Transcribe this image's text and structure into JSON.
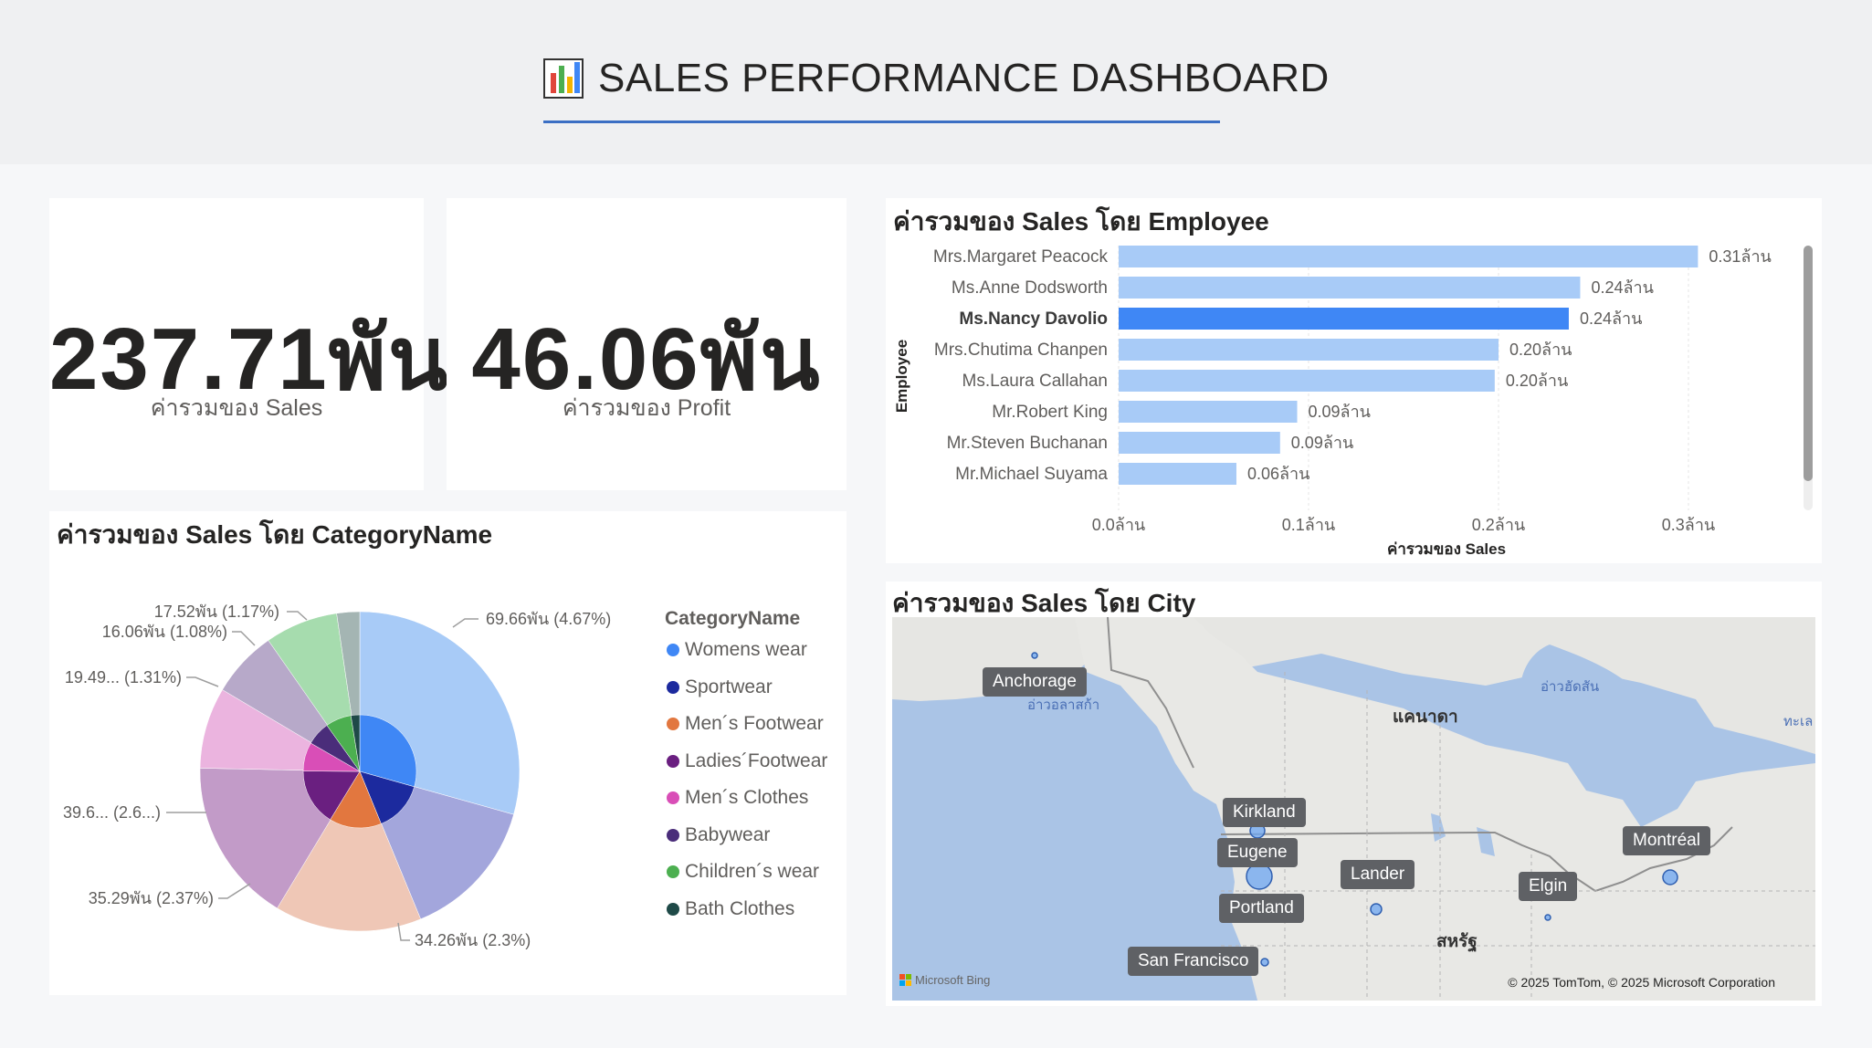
{
  "header": {
    "title": "SALES PERFORMANCE DASHBOARD",
    "icon": "bar-chart-icon"
  },
  "kpis": [
    {
      "value": "237.71พัน",
      "label": "ค่ารวมของ Sales"
    },
    {
      "value": "46.06พัน",
      "label": "ค่ารวมของ Profit"
    }
  ],
  "employee_chart": {
    "title": "ค่ารวมของ Sales โดย Employee",
    "ylabel": "Employee",
    "xlabel": "ค่ารวมของ Sales",
    "ticks": [
      "0.0ล้าน",
      "0.1ล้าน",
      "0.2ล้าน",
      "0.3ล้าน"
    ]
  },
  "category_chart": {
    "title": "ค่ารวมของ Sales โดย CategoryName",
    "legend_title": "CategoryName",
    "labels": [
      "69.66พัน (4.67%)",
      "34.26พัน (2.3%)",
      "35.29พัน (2.37%)",
      "39.6... (2.6...)",
      "19.49... (1.31%)",
      "16.06พัน (1.08%)",
      "17.52พัน (1.17%)"
    ]
  },
  "map": {
    "title": "ค่ารวมของ Sales โดย City",
    "cities": [
      "Anchorage",
      "Kirkland",
      "Eugene",
      "Portland",
      "Lander",
      "Elgin",
      "Montréal",
      "San Francisco"
    ],
    "countries": [
      "แคนาดา",
      "สหรัฐ"
    ],
    "water": [
      "อ่าวอลาสก้า",
      "อ่าวฮัดสัน",
      "ทะเล"
    ],
    "attribution": "© 2025 TomTom, © 2025 Microsoft Corporation",
    "bing": "Microsoft Bing"
  },
  "chart_data": [
    {
      "type": "bar",
      "orientation": "horizontal",
      "title": "ค่ารวมของ Sales โดย Employee",
      "xlabel": "ค่ารวมของ Sales",
      "ylabel": "Employee",
      "xlim": [
        0,
        0.33
      ],
      "categories": [
        "Mrs.Margaret Peacock",
        "Ms.Anne Dodsworth",
        "Ms.Nancy Davolio",
        "Mrs.Chutima Chanpen",
        "Ms.Laura Callahan",
        "Mr.Robert King",
        "Mr.Steven Buchanan",
        "Mr.Michael Suyama"
      ],
      "values": [
        0.305,
        0.243,
        0.237,
        0.2,
        0.198,
        0.094,
        0.085,
        0.062
      ],
      "value_labels": [
        "0.31ล้าน",
        "0.24ล้าน",
        "0.24ล้าน",
        "0.20ล้าน",
        "0.20ล้าน",
        "0.09ล้าน",
        "0.09ล้าน",
        "0.06ล้าน"
      ],
      "highlighted": "Ms.Nancy Davolio",
      "colors": {
        "bar": "#a8cbf7",
        "highlight": "#3f87f5"
      }
    },
    {
      "type": "pie",
      "title": "ค่ารวมของ Sales โดย CategoryName",
      "legend": "right",
      "series": [
        "Womens wear",
        "Sportwear",
        "Men´s Footwear",
        "Ladies´Footwear",
        "Men´s Clothes",
        "Babywear",
        "Children´s wear",
        "Bath Clothes"
      ],
      "series_colors": [
        "#3f87f5",
        "#1c2a9e",
        "#e2773f",
        "#6a1f80",
        "#d94eb7",
        "#4a2d7a",
        "#4caf50",
        "#1f4a48"
      ],
      "outer_values": [
        69.66,
        34.26,
        35.29,
        39.6,
        19.49,
        16.06,
        17.52,
        5.5
      ],
      "outer_labels": [
        "69.66พัน (4.67%)",
        "34.26พัน (2.3%)",
        "35.29พัน (2.37%)",
        "39.6... (2.6...)",
        "19.49... (1.31%)",
        "16.06พัน (1.08%)",
        "17.52พัน (1.17%)",
        ""
      ],
      "outer_colors": [
        "#a8cbf7",
        "#a3a6dc",
        "#efc7b6",
        "#c29bc8",
        "#ebb4df",
        "#b7a9c9",
        "#a6dcae",
        "#a4b5b3"
      ],
      "inner_values": [
        4.67,
        2.3,
        2.37,
        2.6,
        1.31,
        1.08,
        1.17,
        0.4
      ]
    }
  ],
  "bar_colors": {
    "normal": "#a8cbf7",
    "highlight": "#3f87f5"
  }
}
